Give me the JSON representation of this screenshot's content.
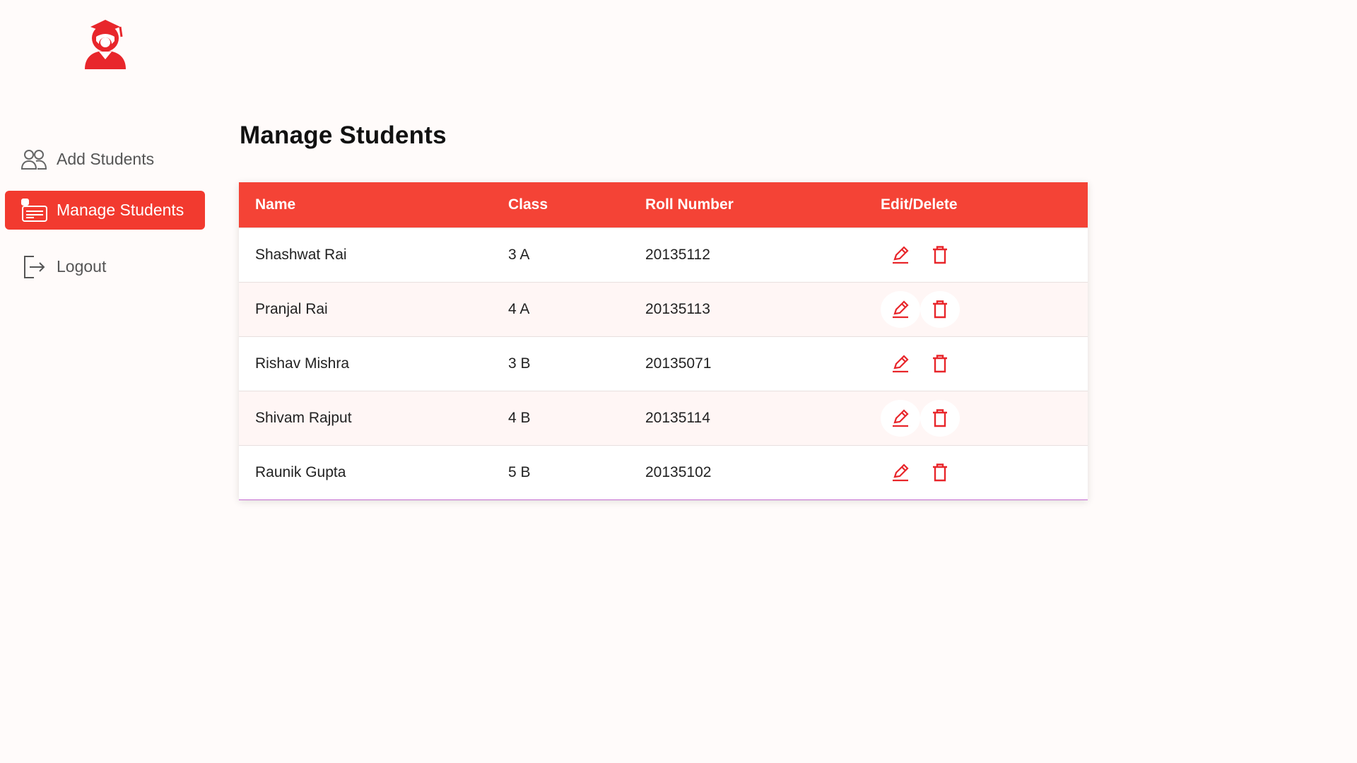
{
  "app": {
    "logo_icon": "student-graduate-icon",
    "accent_color": "#f23a2f"
  },
  "sidebar": {
    "items": [
      {
        "label": "Add Students",
        "icon": "users-icon",
        "active": false
      },
      {
        "label": "Manage Students",
        "icon": "id-card-icon",
        "active": true
      },
      {
        "label": "Logout",
        "icon": "logout-icon",
        "active": false
      }
    ]
  },
  "main": {
    "title": "Manage Students",
    "table": {
      "headers": [
        "Name",
        "Class",
        "Roll Number",
        "Edit/Delete"
      ],
      "rows": [
        {
          "name": "Shashwat Rai",
          "class": "3 A",
          "roll": "20135112"
        },
        {
          "name": "Pranjal Rai",
          "class": "4 A",
          "roll": "20135113"
        },
        {
          "name": "Rishav Mishra",
          "class": "3 B",
          "roll": "20135071"
        },
        {
          "name": "Shivam Rajput",
          "class": "4 B",
          "roll": "20135114"
        },
        {
          "name": "Raunik Gupta",
          "class": "5 B",
          "roll": "20135102"
        }
      ],
      "row_actions": {
        "edit_icon": "pencil-icon",
        "delete_icon": "trash-icon"
      }
    }
  }
}
